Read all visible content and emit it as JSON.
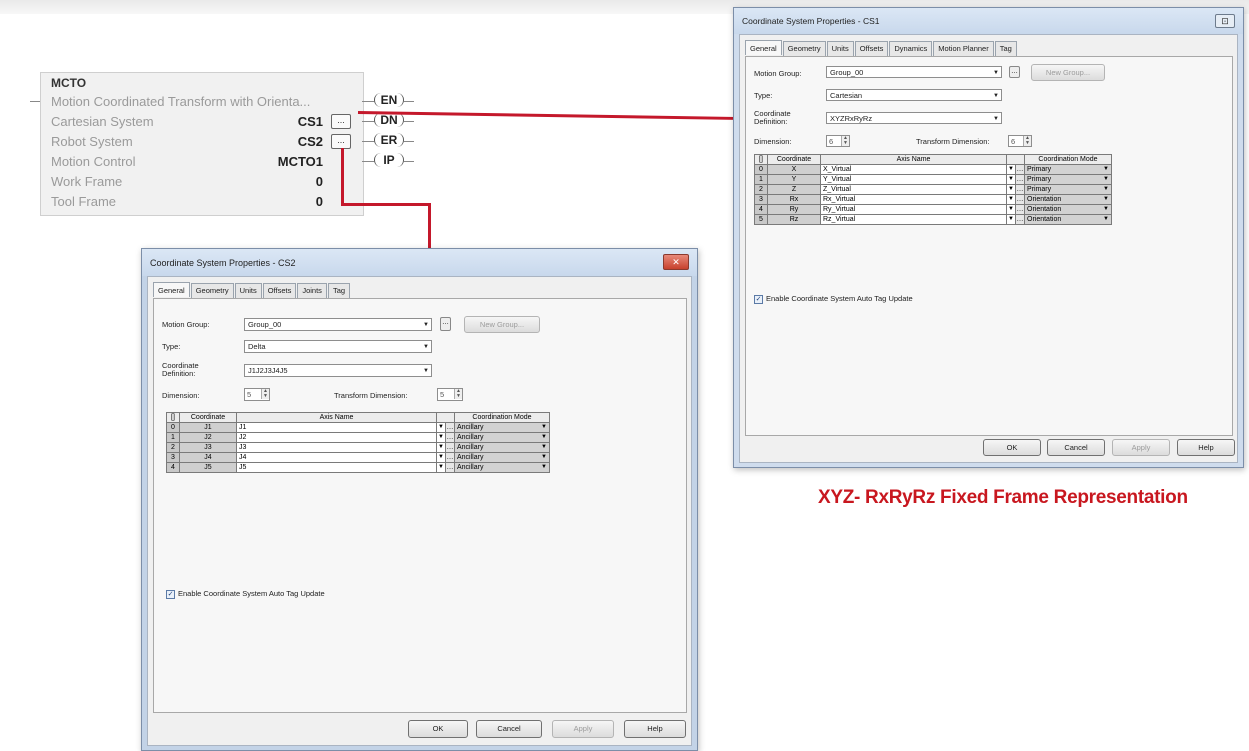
{
  "ladder": {
    "instruction": "MCTO",
    "description": "Motion Coordinated Transform with Orienta...",
    "params": [
      {
        "label": "Cartesian System",
        "value": "CS1",
        "browse": "..."
      },
      {
        "label": "Robot System",
        "value": "CS2",
        "browse": "..."
      },
      {
        "label": "Motion Control",
        "value": "MCTO1"
      },
      {
        "label": "Work Frame",
        "value": "0"
      },
      {
        "label": "Tool Frame",
        "value": "0"
      }
    ],
    "outputs": [
      "EN",
      "DN",
      "ER",
      "IP"
    ]
  },
  "dialog_cs1": {
    "title": "Coordinate System Properties - CS1",
    "close": "⊡",
    "tabs": [
      "General",
      "Geometry",
      "Units",
      "Offsets",
      "Dynamics",
      "Motion Planner",
      "Tag"
    ],
    "motion_group_label": "Motion Group:",
    "motion_group": "Group_00",
    "new_group": "New Group...",
    "type_label": "Type:",
    "type": "Cartesian",
    "coord_def_label": "Coordinate Definition:",
    "coord_def": "XYZRxRyRz",
    "dimension_label": "Dimension:",
    "dimension": "6",
    "transform_dimension_label": "Transform Dimension:",
    "transform_dimension": "6",
    "grid_headers": [
      "[]",
      "Coordinate",
      "Axis Name",
      "",
      "Coordination Mode"
    ],
    "rows": [
      {
        "idx": "0",
        "coord": "X",
        "axis": "X_Virtual",
        "mode": "Primary"
      },
      {
        "idx": "1",
        "coord": "Y",
        "axis": "Y_Virtual",
        "mode": "Primary"
      },
      {
        "idx": "2",
        "coord": "Z",
        "axis": "Z_Virtual",
        "mode": "Primary"
      },
      {
        "idx": "3",
        "coord": "Rx",
        "axis": "Rx_Virtual",
        "mode": "Orientation"
      },
      {
        "idx": "4",
        "coord": "Ry",
        "axis": "Ry_Virtual",
        "mode": "Orientation"
      },
      {
        "idx": "5",
        "coord": "Rz",
        "axis": "Rz_Virtual",
        "mode": "Orientation"
      }
    ],
    "auto_tag": "Enable Coordinate System Auto Tag Update",
    "buttons": {
      "ok": "OK",
      "cancel": "Cancel",
      "apply": "Apply",
      "help": "Help"
    }
  },
  "dialog_cs2": {
    "title": "Coordinate System Properties - CS2",
    "close": "✕",
    "tabs": [
      "General",
      "Geometry",
      "Units",
      "Offsets",
      "Joints",
      "Tag"
    ],
    "motion_group_label": "Motion Group:",
    "motion_group": "Group_00",
    "new_group": "New Group...",
    "type_label": "Type:",
    "type": "Delta",
    "coord_def_label": "Coordinate Definition:",
    "coord_def": "J1J2J3J4J5",
    "dimension_label": "Dimension:",
    "dimension": "5",
    "transform_dimension_label": "Transform Dimension:",
    "transform_dimension": "5",
    "grid_headers": [
      "[]",
      "Coordinate",
      "Axis Name",
      "",
      "Coordination Mode"
    ],
    "rows": [
      {
        "idx": "0",
        "coord": "J1",
        "axis": "J1",
        "mode": "Ancillary"
      },
      {
        "idx": "1",
        "coord": "J2",
        "axis": "J2",
        "mode": "Ancillary"
      },
      {
        "idx": "2",
        "coord": "J3",
        "axis": "J3",
        "mode": "Ancillary"
      },
      {
        "idx": "3",
        "coord": "J4",
        "axis": "J4",
        "mode": "Ancillary"
      },
      {
        "idx": "4",
        "coord": "J5",
        "axis": "J5",
        "mode": "Ancillary"
      }
    ],
    "auto_tag": "Enable Coordinate System Auto Tag Update",
    "buttons": {
      "ok": "OK",
      "cancel": "Cancel",
      "apply": "Apply",
      "help": "Help"
    }
  },
  "caption": "XYZ- RxRyRz Fixed Frame Representation",
  "colors": {
    "connector": "#c4182b",
    "caption": "#c8171f"
  }
}
